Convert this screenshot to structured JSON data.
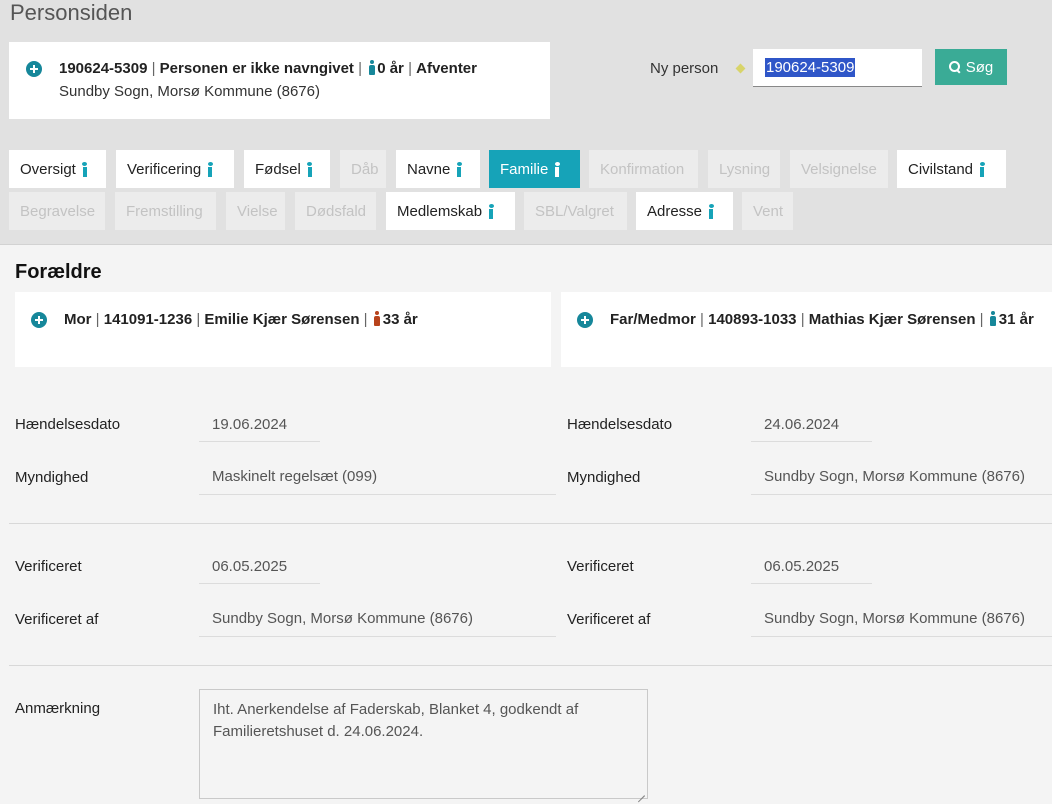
{
  "page": {
    "title": "Personsiden"
  },
  "person": {
    "cpr": "190624-5309",
    "name": "Personen er ikke navngivet",
    "age": "0 år",
    "status": "Afventer",
    "parish": "Sundby Sogn, Morsø Kommune (8676)"
  },
  "search": {
    "label": "Ny person",
    "value": "190624-5309",
    "button": "Søg"
  },
  "tabs": [
    {
      "label": "Oversigt"
    },
    {
      "label": "Verificering"
    },
    {
      "label": "Fødsel"
    },
    {
      "label": "Dåb"
    },
    {
      "label": "Navne"
    },
    {
      "label": "Familie"
    },
    {
      "label": "Konfirmation"
    },
    {
      "label": "Lysning"
    },
    {
      "label": "Velsignelse"
    },
    {
      "label": "Civilstand"
    },
    {
      "label": "Begravelse"
    },
    {
      "label": "Fremstilling"
    },
    {
      "label": "Vielse"
    },
    {
      "label": "Dødsfald"
    },
    {
      "label": "Medlemskab"
    },
    {
      "label": "SBL/Valgret"
    },
    {
      "label": "Adresse"
    },
    {
      "label": "Vent"
    }
  ],
  "parents": {
    "title": "Forældre",
    "mother": {
      "role": "Mor",
      "cpr": "141091-1236",
      "name": "Emilie Kjær Sørensen",
      "age": "33 år",
      "color": "#b8431c"
    },
    "father": {
      "role": "Far/Medmor",
      "cpr": "140893-1033",
      "name": "Mathias Kjær Sørensen",
      "age": "31 år",
      "color": "#16879a"
    }
  },
  "details": {
    "left": {
      "event_date_label": "Hændelsesdato",
      "event_date": "19.06.2024",
      "authority_label": "Myndighed",
      "authority": "Maskinelt regelsæt (099)",
      "verified_label": "Verificeret",
      "verified": "06.05.2025",
      "verified_by_label": "Verificeret af",
      "verified_by": "Sundby Sogn, Morsø Kommune (8676)"
    },
    "right": {
      "event_date_label": "Hændelsesdato",
      "event_date": "24.06.2024",
      "authority_label": "Myndighed",
      "authority": "Sundby Sogn, Morsø Kommune (8676)",
      "verified_label": "Verificeret",
      "verified": "06.05.2025",
      "verified_by_label": "Verificeret af",
      "verified_by": "Sundby Sogn, Morsø Kommune (8676)"
    },
    "remark_label": "Anmærkning",
    "remark": "Iht. Anerkendelse af Faderskab, Blanket 4, godkendt af Familieretshuset d. 24.06.2024."
  },
  "colors": {
    "accent": "#16a3b8",
    "search_button": "#3aab96",
    "icon_teal": "#16879a",
    "header_bg": "#e1e1e1"
  }
}
